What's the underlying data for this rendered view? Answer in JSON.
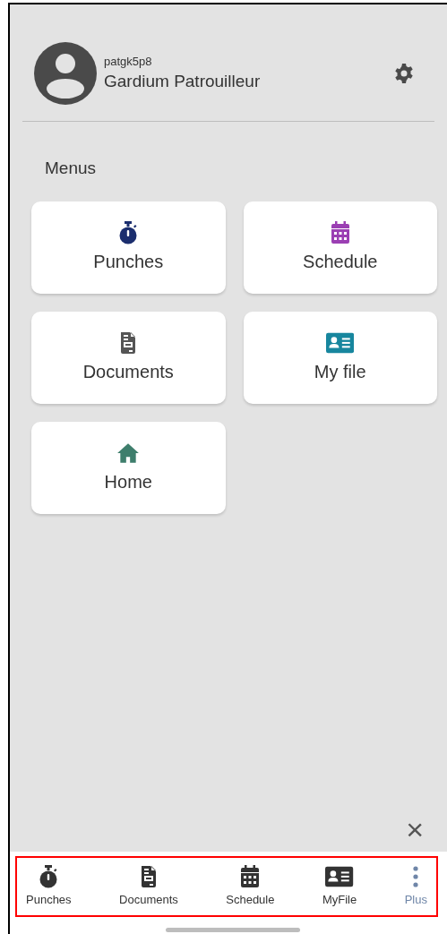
{
  "profile": {
    "username": "patgk5p8",
    "name": "Gardium Patrouilleur"
  },
  "menus": {
    "title": "Menus",
    "items": [
      {
        "label": "Punches",
        "kind": "stopwatch",
        "color": "#1b2e6e"
      },
      {
        "label": "Schedule",
        "kind": "calendar",
        "color": "#9b3fb3"
      },
      {
        "label": "Documents",
        "kind": "document",
        "color": "#555555"
      },
      {
        "label": "My file",
        "kind": "idcard",
        "color": "#17869e"
      },
      {
        "label": "Home",
        "kind": "home",
        "color": "#3e7e6c"
      }
    ]
  },
  "close": "×",
  "bottom_nav": [
    {
      "label": "Punches",
      "kind": "stopwatch",
      "selected": false
    },
    {
      "label": "Documents",
      "kind": "document",
      "selected": false
    },
    {
      "label": "Schedule",
      "kind": "calendar",
      "selected": false
    },
    {
      "label": "MyFile",
      "kind": "idcard",
      "selected": false
    },
    {
      "label": "Plus",
      "kind": "more",
      "selected": true
    }
  ]
}
